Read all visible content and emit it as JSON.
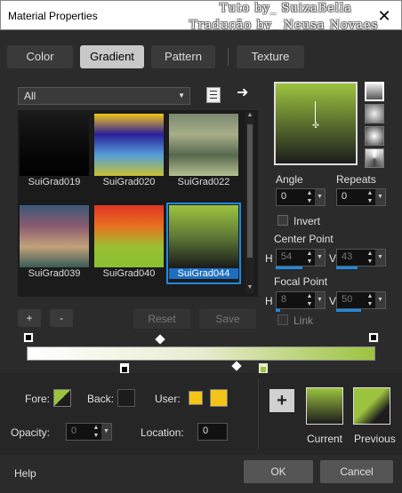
{
  "window": {
    "title": "Material Properties",
    "close_glyph": "✕"
  },
  "watermark": {
    "line1": "Tuto by_ SuizaBella",
    "line2": "Tradução by_ Neusa Novaes"
  },
  "tabs": [
    {
      "label": "Color",
      "active": false
    },
    {
      "label": "Gradient",
      "active": true
    },
    {
      "label": "Pattern",
      "active": false
    },
    {
      "label": "Texture",
      "active": false
    }
  ],
  "library": {
    "category_value": "All",
    "book_icon": "book-icon",
    "arrow_icon": "arrow-right-icon"
  },
  "gradients": [
    {
      "name": "SuiGrad019",
      "colors": [
        "#1a1a1a",
        "#0a0a0a",
        "#000000"
      ]
    },
    {
      "name": "SuiGrad020",
      "colors": [
        "#f3c51b",
        "#2b1f9a",
        "#54a0d8",
        "#c8c030"
      ]
    },
    {
      "name": "SuiGrad022",
      "colors": [
        "#7d8870",
        "#a8ae88",
        "#56684e",
        "#b5c090"
      ]
    },
    {
      "name": "SuiGrad039",
      "colors": [
        "#3a5a78",
        "#8a5a70",
        "#c2a27a",
        "#3a5a58"
      ]
    },
    {
      "name": "SuiGrad040",
      "colors": [
        "#e03525",
        "#e87020",
        "#9ac030",
        "#88c033"
      ]
    },
    {
      "name": "SuiGrad044",
      "colors": [
        "#9cc33f",
        "#5f7a35",
        "#1c1c1c"
      ]
    }
  ],
  "selected_gradient": "SuiGrad044",
  "list_buttons": {
    "add": "+",
    "remove": "-",
    "reset": "Reset",
    "save": "Save"
  },
  "preview": {
    "colors": [
      "#9cc33f",
      "#1c1c1c"
    ]
  },
  "angle": {
    "label": "Angle",
    "value": "0"
  },
  "repeats": {
    "label": "Repeats",
    "value": "0"
  },
  "invert": {
    "label": "Invert",
    "checked": false
  },
  "center_point": {
    "label": "Center Point",
    "h_label": "H",
    "h_value": "54",
    "v_label": "V",
    "v_value": "43"
  },
  "focal_point": {
    "label": "Focal Point",
    "h_label": "H",
    "h_value": "8",
    "v_label": "V",
    "v_value": "50"
  },
  "link": {
    "label": "Link",
    "checked": false
  },
  "gradient_bar": {
    "colors": [
      "#ffffff",
      "#e8ecd0",
      "#9cc33f"
    ]
  },
  "fore": {
    "label": "Fore:"
  },
  "back": {
    "label": "Back:"
  },
  "user": {
    "label": "User:",
    "color1": "#f3c51b",
    "color2": "#f3c51b"
  },
  "opacity": {
    "label": "Opacity:",
    "value": "0"
  },
  "location": {
    "label": "Location:",
    "value": "0"
  },
  "current": {
    "label": "Current"
  },
  "previous": {
    "label": "Previous"
  },
  "footer": {
    "help": "Help",
    "ok": "OK",
    "cancel": "Cancel"
  }
}
